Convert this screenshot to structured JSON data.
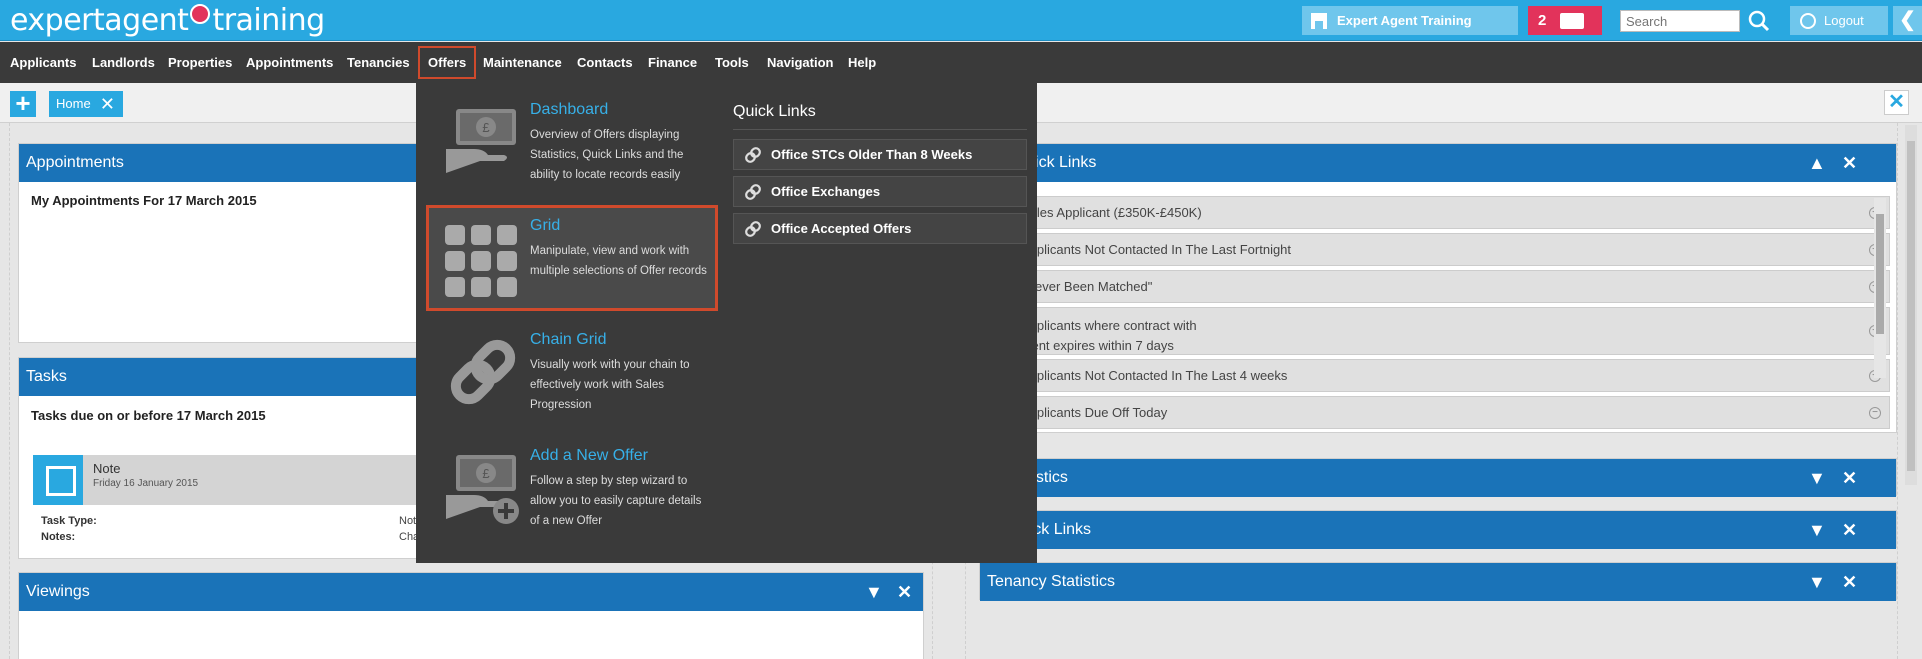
{
  "brand": {
    "logo_text_a": "expertagent",
    "logo_text_b": "training"
  },
  "header": {
    "office_label": "Expert Agent Training",
    "message_count": "2",
    "search_placeholder": "Search",
    "logout_label": "Logout",
    "collapse_glyph": "❮"
  },
  "nav": {
    "items": [
      "Applicants",
      "Landlords",
      "Properties",
      "Appointments",
      "Tenancies",
      "Offers",
      "Maintenance",
      "Contacts",
      "Finance",
      "Tools",
      "Navigation",
      "Help"
    ],
    "active": "Offers"
  },
  "tabs": {
    "add_glyph": "+",
    "home_label": "Home",
    "close_glyph": "✕"
  },
  "offers_menu": {
    "items": [
      {
        "title": "Dashboard",
        "desc": "Overview of Offers displaying Statistics, Quick Links and the ability to locate records easily",
        "icon": "money-hand-icon"
      },
      {
        "title": "Grid",
        "desc": "Manipulate, view and work with multiple selections of Offer records",
        "icon": "grid-icon"
      },
      {
        "title": "Chain Grid",
        "desc": "Visually work with your chain to effectively work with Sales Progression",
        "icon": "chain-icon"
      },
      {
        "title": "Add a New Offer",
        "desc": "Follow a step by step wizard to allow you to easily capture details of a new Offer",
        "icon": "add-offer-icon"
      }
    ],
    "quick_links_title": "Quick Links",
    "quick_links": [
      "Office STCs Older Than 8 Weeks",
      "Office Exchanges",
      "Office Accepted Offers"
    ]
  },
  "appointments": {
    "title": "Appointments",
    "subtitle": "My Appointments For 17 March 2015"
  },
  "tasks": {
    "title": "Tasks",
    "subtitle": "Tasks due on or before 17 March 2015",
    "card_title": "Note",
    "card_date": "Friday 16 January 2015",
    "type_label": "Task Type:",
    "notes_label": "Notes:",
    "type_value": "Not",
    "notes_value": "Cha"
  },
  "viewings": {
    "title": "Viewings"
  },
  "applicant_quick_links": {
    "title": "ant Quick Links",
    "items": [
      "Sales Applicant (£350K-£450K)",
      "Applicants Not Contacted In The Last Fortnight",
      "\"Never Been Matched\"",
      "Applicants where contract with agent expires within 7 days",
      "Applicants Not Contacted In The Last 4 weeks",
      "Applicants Due Off Today"
    ],
    "item_line2": "agent expires within 7 days",
    "item_line1": "Applicants where contract with"
  },
  "right_panels": {
    "property_statistics": "ty Statistics",
    "listings_quick_links": "gs Quick Links",
    "tenancy_statistics": "Tenancy Statistics"
  },
  "colors": {
    "brand_blue": "#29a8e0",
    "panel_blue": "#1a73b8",
    "nav_dark": "#3a3a3a",
    "alert_red": "#e2335b",
    "highlight": "#d04a2c"
  }
}
